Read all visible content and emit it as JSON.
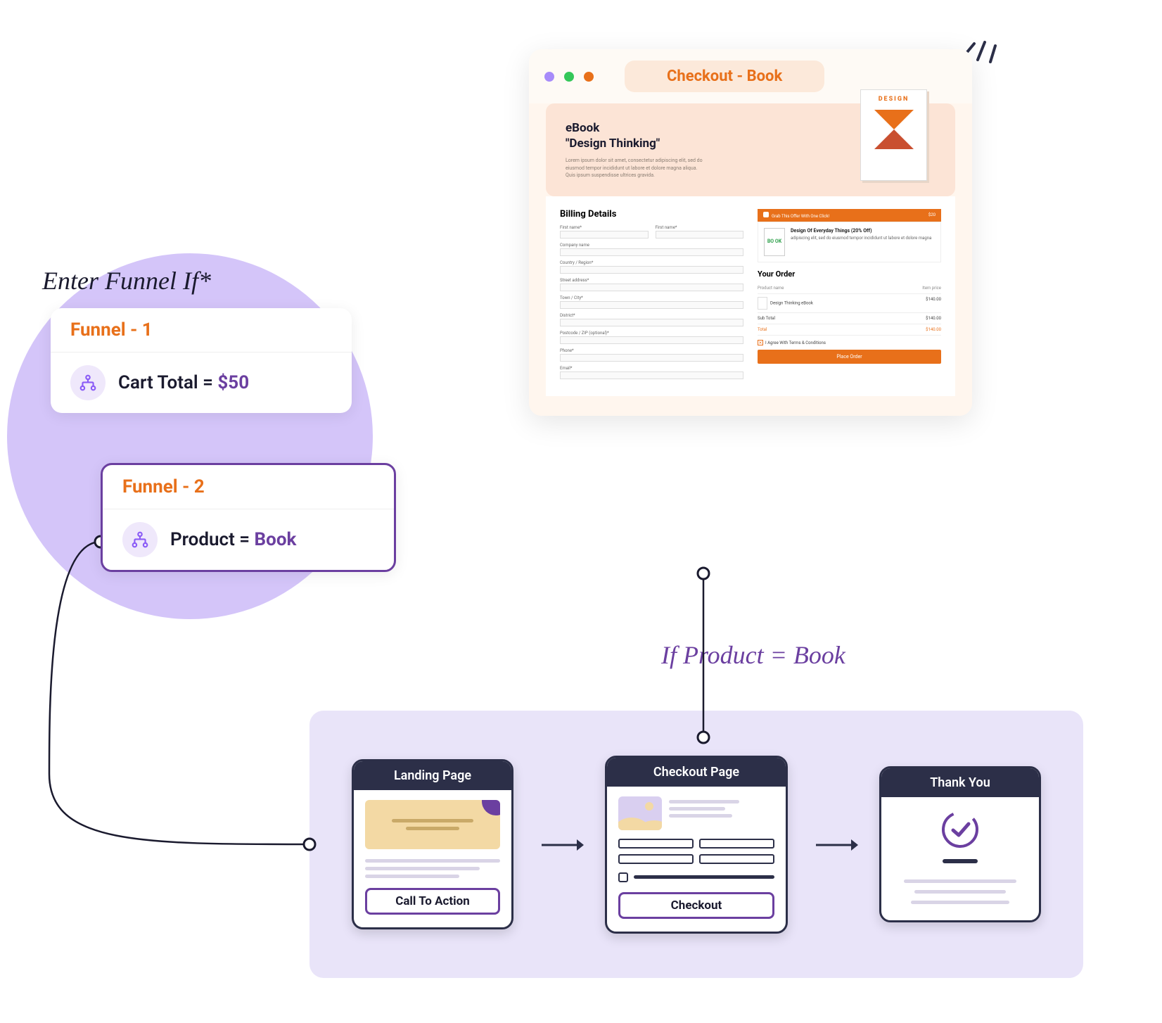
{
  "labels": {
    "enter_funnel_if": "Enter Funnel If*",
    "if_product_book": "If Product = Book"
  },
  "funnels": {
    "f1": {
      "title": "Funnel - 1",
      "rule_pre": "Cart Total = ",
      "rule_val": "$50"
    },
    "f2": {
      "title": "Funnel - 2",
      "rule_pre": "Product = ",
      "rule_val": "Book"
    }
  },
  "browser": {
    "title": "Checkout - Book",
    "hero_title_line1": "eBook",
    "hero_title_line2": "\"Design Thinking\"",
    "hero_desc": "Lorem ipsum dolor sit amet, consectetur adipiscing elit, sed do eiusmod tempor incididunt ut labore et dolore magna aliqua. Quis ipsum suspendisse ultrices gravida.",
    "book_cover_title": "DESIGN",
    "billing": {
      "heading": "Billing Details",
      "first_name": "First name*",
      "last_name": "First name*",
      "company": "Company name",
      "country": "Country / Region*",
      "street": "Street address*",
      "town": "Town / City*",
      "district": "District*",
      "postcode": "Postcode / ZIP (optional)*",
      "phone": "Phone*",
      "email": "Email*"
    },
    "offer": {
      "banner_text": "Grab This Offer With One Click!",
      "banner_price": "$20",
      "thumb_text": "BO OK",
      "title": "Design Of Everyday Things (20% Off)",
      "desc": "adipiscing elit, sed do eiusmod tempor incididunt ut labore et dolore magna"
    },
    "order": {
      "heading": "Your Order",
      "col_product": "Product name",
      "col_price": "Item price",
      "item_name": "Design Thinking eBook",
      "item_price": "$140.00",
      "subtotal_label": "Sub Total",
      "subtotal_value": "$140.00",
      "total_label": "Total",
      "total_value": "$140.00",
      "terms": "I Agree With Terms & Conditions",
      "place_order": "Place Order"
    }
  },
  "flow": {
    "landing": {
      "title": "Landing Page",
      "cta": "Call To Action"
    },
    "checkout": {
      "title": "Checkout Page",
      "cta": "Checkout"
    },
    "thankyou": {
      "title": "Thank You"
    }
  }
}
